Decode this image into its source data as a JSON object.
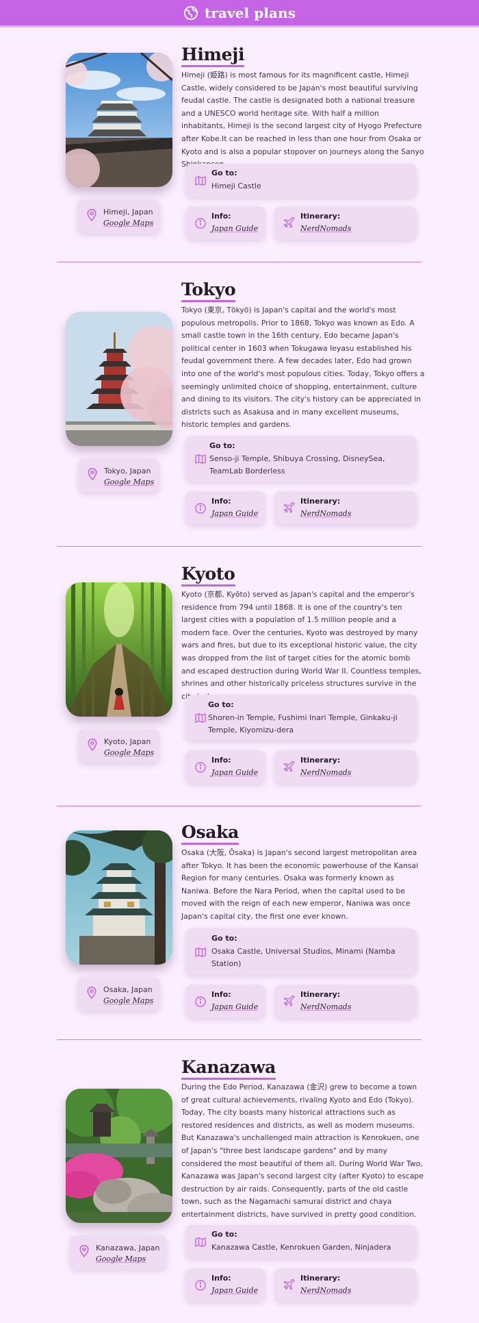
{
  "app": {
    "title": "travel plans",
    "logo_icon": "globe-icon",
    "accent": "#c565e6"
  },
  "labels": {
    "go_to": "Go to:",
    "info": "Info:",
    "itinerary": "Itinerary:",
    "maps": "Google Maps"
  },
  "cities": [
    {
      "name": "Himeji",
      "location": "Himeji, Japan",
      "description": "Himeji (姫路) is most famous for its magnificent castle, Himeji Castle, widely considered to be Japan's most beautiful surviving feudal castle. The castle is designated both a national treasure and a UNESCO world heritage site. With half a million inhabitants, Himeji is the second largest city of Hyogo Prefecture after Kobe.It can be reached in less than one hour from Osaka or Kyoto and is also a popular stopover on journeys along the Sanyo Shinkansen.",
      "go_to": "Himeji Castle",
      "info_link": "Japan Guide",
      "itinerary_link": "NerdNomads"
    },
    {
      "name": "Tokyo",
      "location": "Tokyo, Japan",
      "description": "Tokyo (東京, Tōkyō) is Japan's capital and the world's most populous metropolis. Prior to 1868, Tokyo was known as Edo. A small castle town in the 16th century, Edo became Japan's political center in 1603 when Tokugawa Ieyasu established his feudal government there. A few decades later, Edo had grown into one of the world's most populous cities. Today, Tokyo offers a seemingly unlimited choice of shopping, entertainment, culture and dining to its visitors. The city's history can be appreciated in districts such as Asakusa and in many excellent museums, historic temples and gardens.",
      "go_to": "Senso-ji Temple, Shibuya Crossing, DisneySea, TeamLab Borderless",
      "info_link": "Japan Guide",
      "itinerary_link": "NerdNomads"
    },
    {
      "name": "Kyoto",
      "location": "Kyoto, Japan",
      "description": "Kyoto (京都, Kyōto) served as Japan's capital and the emperor's residence from 794 until 1868. It is one of the country's ten largest cities with a population of 1.5 million people and a modern face. Over the centuries, Kyoto was destroyed by many wars and fires, but due to its exceptional historic value, the city was dropped from the list of target cities for the atomic bomb and escaped destruction during World War II. Countless temples, shrines and other historically priceless structures survive in the city today.",
      "go_to": "Shoren-in Temple, Fushimi Inari Temple, Ginkaku-ji Temple, Kiyomizu-dera",
      "info_link": "Japan Guide",
      "itinerary_link": "NerdNomads"
    },
    {
      "name": "Osaka",
      "location": "Osaka, Japan",
      "description": "Osaka (大阪, Ōsaka) is Japan's second largest metropolitan area after Tokyo. It has been the economic powerhouse of the Kansai Region for many centuries. Osaka was formerly known as Naniwa. Before the Nara Period, when the capital used to be moved with the reign of each new emperor, Naniwa was once Japan's capital city, the first one ever known.",
      "go_to": "Osaka Castle, Universal Studios, Minami (Namba Station)",
      "info_link": "Japan Guide",
      "itinerary_link": "NerdNomads"
    },
    {
      "name": "Kanazawa",
      "location": "Kanazawa, Japan",
      "description": "During the Edo Period, Kanazawa (金沢) grew to become a town of great cultural achievements, rivaling Kyoto and Edo (Tokyo). Today, The city boasts many historical attractions such as restored residences and districts, as well as modern museums. But Kanazawa's unchallenged main attraction is Kenrokuen, one of Japan's \"three best landscape gardens\" and by many considered the most beautiful of them all. During World War Two, Kanazawa was Japan's second largest city (after Kyoto) to escape destruction by air raids. Consequently, parts of the old castle town, such as the Nagamachi samurai district and chaya entertainment districts, have survived in pretty good condition.",
      "go_to": "Kanazawa Castle, Kenrokuen Garden, Ninjadera",
      "info_link": "Japan Guide",
      "itinerary_link": "NerdNomads"
    }
  ]
}
